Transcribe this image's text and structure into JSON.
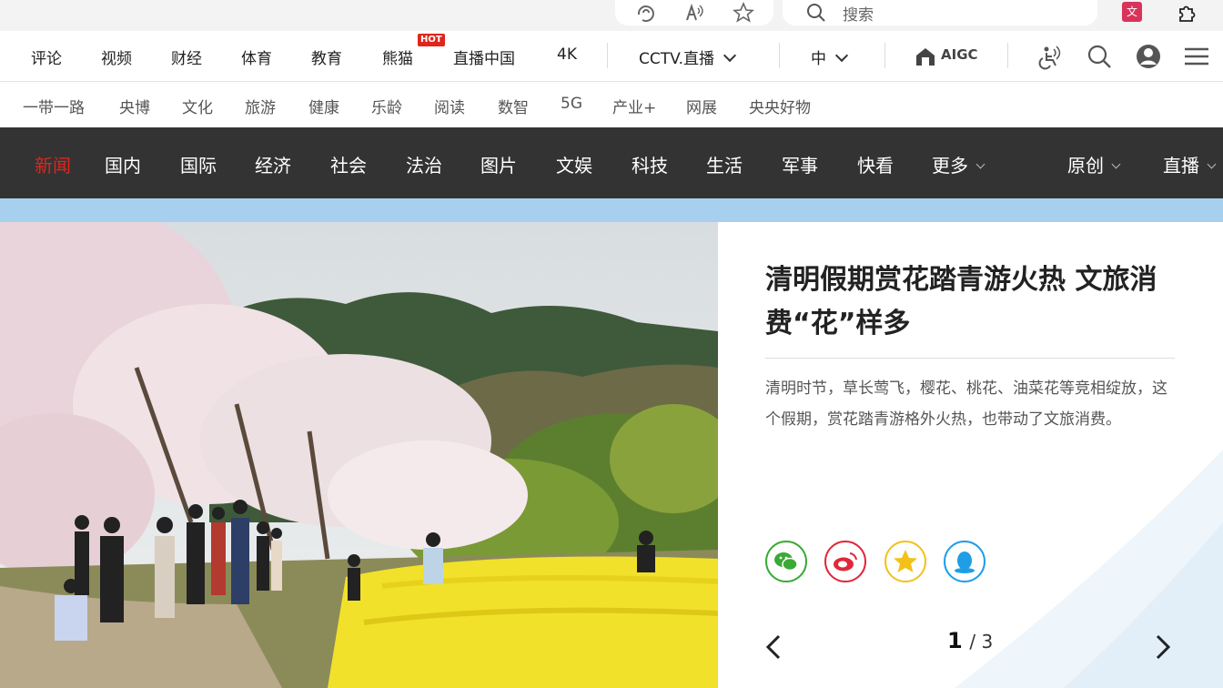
{
  "browser": {
    "search_placeholder": "搜索",
    "extension_label": "𝔄"
  },
  "nav_primary": {
    "items": [
      "评论",
      "视频",
      "财经",
      "体育",
      "教育",
      "熊猫",
      "直播中国",
      "4K"
    ],
    "hot_badge": "HOT",
    "live_dropdown": "CCTV.直播",
    "lang_dropdown": "中",
    "aigc_label": "AIGC"
  },
  "nav_secondary": {
    "items": [
      "一带一路",
      "央博",
      "文化",
      "旅游",
      "健康",
      "乐龄",
      "阅读",
      "数智",
      "5G",
      "产业+",
      "网展",
      "央央好物"
    ]
  },
  "nav_channels": {
    "items": [
      "新闻",
      "国内",
      "国际",
      "经济",
      "社会",
      "法治",
      "图片",
      "文娱",
      "科技",
      "生活",
      "军事",
      "快看"
    ],
    "active": "新闻",
    "more": "更多",
    "original": "原创",
    "live": "直播"
  },
  "hero": {
    "headline": "清明假期赏花踏青游火热 文旅消费“花”样多",
    "summary": "清明时节，草长莺飞，樱花、桃花、油菜花等竞相绽放，这个假期，赏花踏青游格外火热，也带动了文旅消费。",
    "share_icons": [
      "wechat-icon",
      "weibo-icon",
      "qzone-icon",
      "qq-icon"
    ],
    "page_current": "1",
    "page_total": "/ 3"
  },
  "colors": {
    "accent_red": "#e1251b",
    "dark_nav": "#333333",
    "band_blue": "#a7d0ee"
  }
}
